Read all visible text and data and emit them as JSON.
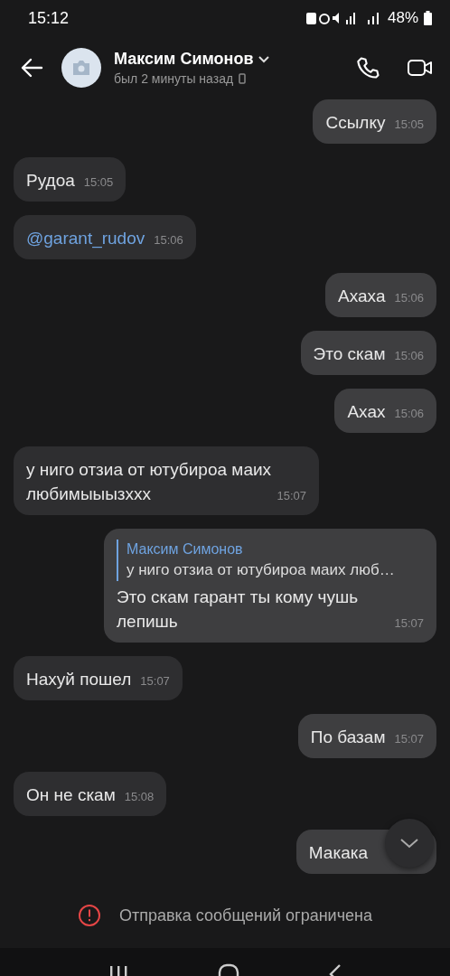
{
  "status_bar": {
    "time": "15:12",
    "battery": "48%"
  },
  "header": {
    "name": "Максим Симонов",
    "presence": "был 2 минуты назад"
  },
  "messages": [
    {
      "kind": "text",
      "outgoing": true,
      "text": "Ссылку",
      "time": "15:05"
    },
    {
      "kind": "text",
      "outgoing": false,
      "text": "Рудоа",
      "time": "15:05"
    },
    {
      "kind": "mention",
      "outgoing": false,
      "text": "@garant_rudov",
      "time": "15:06"
    },
    {
      "kind": "text",
      "outgoing": true,
      "text": "Ахаха",
      "time": "15:06"
    },
    {
      "kind": "text",
      "outgoing": true,
      "text": "Это скам",
      "time": "15:06"
    },
    {
      "kind": "text",
      "outgoing": true,
      "text": "Ахах",
      "time": "15:06"
    },
    {
      "kind": "text",
      "outgoing": false,
      "text": "у ниго отзиа от ютубироа маих любимыыызххх",
      "time": "15:07"
    },
    {
      "kind": "reply",
      "outgoing": true,
      "reply": {
        "author": "Максим Симонов",
        "text": "у ниго отзиа от ютубироа маих люб…"
      },
      "text": "Это скам гарант ты кому чушь лепишь",
      "time": "15:07"
    },
    {
      "kind": "text",
      "outgoing": false,
      "text": "Нахуй пошел",
      "time": "15:07"
    },
    {
      "kind": "text",
      "outgoing": true,
      "text": "По базам",
      "time": "15:07"
    },
    {
      "kind": "text",
      "outgoing": false,
      "text": "Он не скам",
      "time": "15:08"
    },
    {
      "kind": "text",
      "outgoing": true,
      "text": "Макака"
    }
  ],
  "notice": "Отправка сообщений ограничена"
}
